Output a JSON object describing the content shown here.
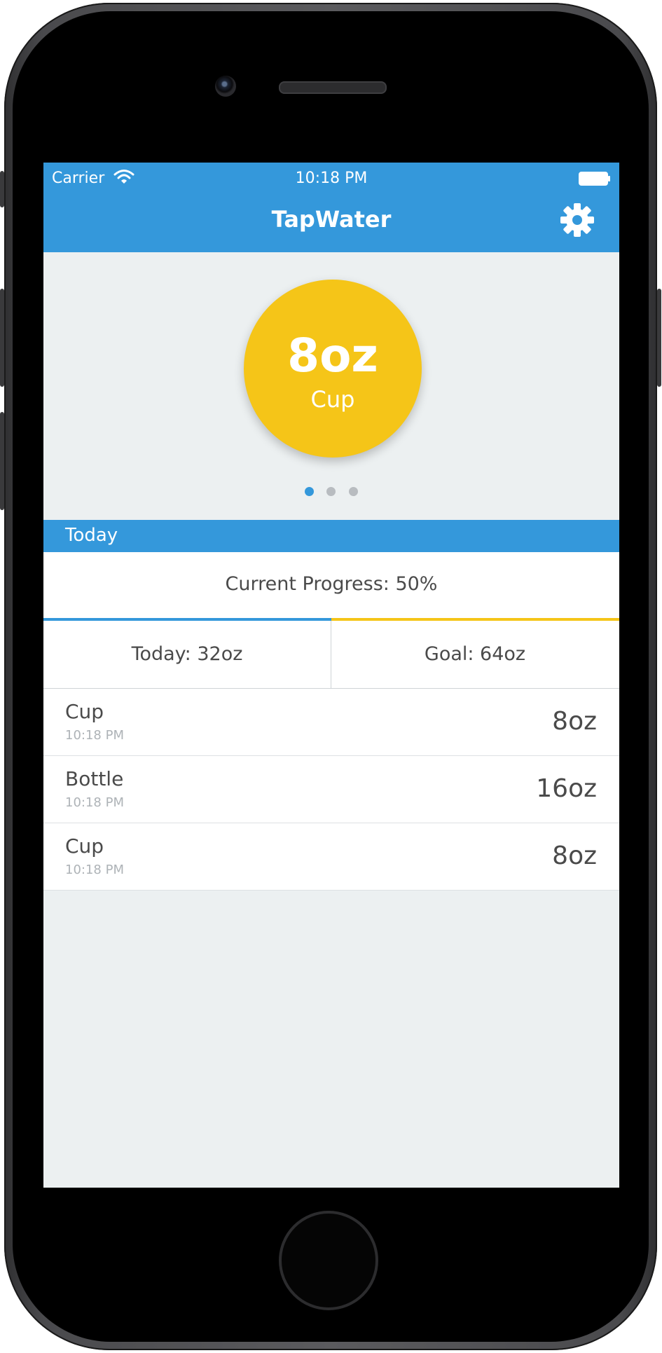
{
  "status_bar": {
    "carrier": "Carrier",
    "time": "10:18 PM"
  },
  "nav": {
    "title": "TapWater",
    "settings_icon": "gear-icon"
  },
  "selector": {
    "amount": "8oz",
    "label": "Cup",
    "page_count": 3,
    "active_page": 0,
    "color": "#f5c518"
  },
  "section": {
    "title": "Today"
  },
  "progress": {
    "label": "Current Progress: 50%",
    "fraction": 0.5,
    "fill_color": "#3498db",
    "track_color": "#f5c518"
  },
  "stats": {
    "today": "Today: 32oz",
    "goal": "Goal: 64oz"
  },
  "log": [
    {
      "name": "Cup",
      "time": "10:18 PM",
      "amount": "8oz"
    },
    {
      "name": "Bottle",
      "time": "10:18 PM",
      "amount": "16oz"
    },
    {
      "name": "Cup",
      "time": "10:18 PM",
      "amount": "8oz"
    }
  ],
  "colors": {
    "accent": "#3498db",
    "background": "#ecf0f1",
    "text": "#4a4a4a"
  }
}
